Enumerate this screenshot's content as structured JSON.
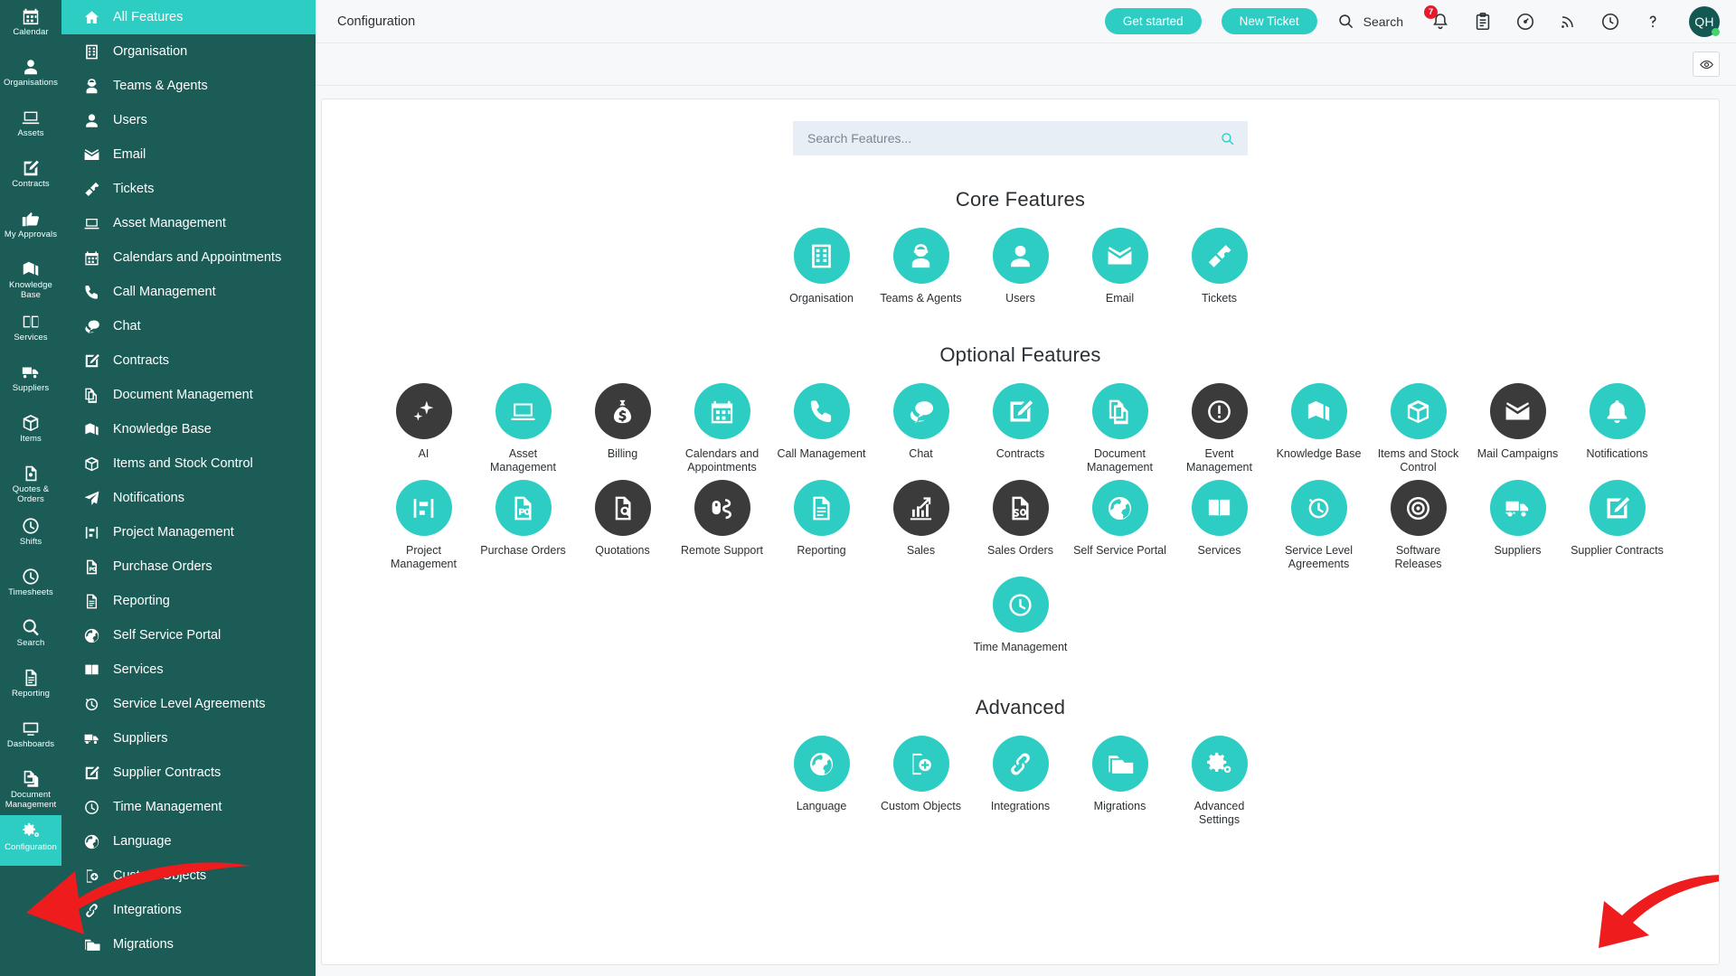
{
  "rail": {
    "items": [
      {
        "label": "Calendar",
        "icon": "calendar-icon",
        "active": false
      },
      {
        "label": "Organisations",
        "icon": "organisations-icon",
        "active": false
      },
      {
        "label": "Assets",
        "icon": "assets-icon",
        "active": false
      },
      {
        "label": "Contracts",
        "icon": "contracts-icon",
        "active": false
      },
      {
        "label": "My Approvals",
        "icon": "approvals-icon",
        "active": false
      },
      {
        "label": "Knowledge Base",
        "icon": "knowledge-base-icon",
        "active": false
      },
      {
        "label": "Services",
        "icon": "services-icon",
        "active": false
      },
      {
        "label": "Suppliers",
        "icon": "suppliers-icon",
        "active": false
      },
      {
        "label": "Items",
        "icon": "items-icon",
        "active": false
      },
      {
        "label": "Quotes & Orders",
        "icon": "quotes-orders-icon",
        "active": false
      },
      {
        "label": "Shifts",
        "icon": "shifts-icon",
        "active": false
      },
      {
        "label": "Timesheets",
        "icon": "timesheets-icon",
        "active": false
      },
      {
        "label": "Search",
        "icon": "search-icon",
        "active": false
      },
      {
        "label": "Reporting",
        "icon": "reporting-icon",
        "active": false
      },
      {
        "label": "Dashboards",
        "icon": "dashboards-icon",
        "active": false
      },
      {
        "label": "Document Management",
        "icon": "document-management-icon",
        "active": false
      },
      {
        "label": "Configuration",
        "icon": "configuration-icon",
        "active": true
      }
    ]
  },
  "featnav": {
    "items": [
      {
        "label": "All Features",
        "icon": "home-icon",
        "active": true
      },
      {
        "label": "Organisation",
        "icon": "building-icon",
        "active": false
      },
      {
        "label": "Teams & Agents",
        "icon": "agent-icon",
        "active": false
      },
      {
        "label": "Users",
        "icon": "user-icon",
        "active": false
      },
      {
        "label": "Email",
        "icon": "envelope-icon",
        "active": false
      },
      {
        "label": "Tickets",
        "icon": "ticket-icon",
        "active": false
      },
      {
        "label": "Asset Management",
        "icon": "laptop-icon",
        "active": false
      },
      {
        "label": "Calendars and Appointments",
        "icon": "calendar-icon",
        "active": false
      },
      {
        "label": "Call Management",
        "icon": "phone-icon",
        "active": false
      },
      {
        "label": "Chat",
        "icon": "chat-icon",
        "active": false
      },
      {
        "label": "Contracts",
        "icon": "pencil-square-icon",
        "active": false
      },
      {
        "label": "Document Management",
        "icon": "documents-icon",
        "active": false
      },
      {
        "label": "Knowledge Base",
        "icon": "books-icon",
        "active": false
      },
      {
        "label": "Items and Stock Control",
        "icon": "box-icon",
        "active": false
      },
      {
        "label": "Notifications",
        "icon": "paper-plane-icon",
        "active": false
      },
      {
        "label": "Project Management",
        "icon": "project-icon",
        "active": false
      },
      {
        "label": "Purchase Orders",
        "icon": "po-icon",
        "active": false
      },
      {
        "label": "Reporting",
        "icon": "report-icon",
        "active": false
      },
      {
        "label": "Self Service Portal",
        "icon": "globe-icon",
        "active": false
      },
      {
        "label": "Services",
        "icon": "book-open-icon",
        "active": false
      },
      {
        "label": "Service Level Agreements",
        "icon": "stopwatch-icon",
        "active": false
      },
      {
        "label": "Suppliers",
        "icon": "truck-icon",
        "active": false
      },
      {
        "label": "Supplier Contracts",
        "icon": "pencil-square-icon",
        "active": false
      },
      {
        "label": "Time Management",
        "icon": "clock-icon",
        "active": false
      },
      {
        "label": "Language",
        "icon": "globe-icon",
        "active": false
      },
      {
        "label": "Custom Objects",
        "icon": "custom-object-icon",
        "active": false
      },
      {
        "label": "Integrations",
        "icon": "link-icon",
        "active": false
      },
      {
        "label": "Migrations",
        "icon": "folder-icon",
        "active": false
      }
    ]
  },
  "topbar": {
    "title": "Configuration",
    "get_started_label": "Get started",
    "new_ticket_label": "New Ticket",
    "search_label": "Search",
    "notification_count": "7",
    "avatar_initials": "QH",
    "icons": [
      "bell-icon",
      "clipboard-icon",
      "gauge-icon",
      "rss-icon",
      "clock-icon",
      "help-icon"
    ]
  },
  "actionbar": {
    "eye_icon": "eye-icon"
  },
  "search": {
    "placeholder": "Search Features...",
    "value": ""
  },
  "sections": [
    {
      "title": "Core Features",
      "tiles": [
        {
          "label": "Organisation",
          "icon": "building-icon",
          "dark": false
        },
        {
          "label": "Teams & Agents",
          "icon": "agent-icon",
          "dark": false
        },
        {
          "label": "Users",
          "icon": "user-icon",
          "dark": false
        },
        {
          "label": "Email",
          "icon": "envelope-icon",
          "dark": false
        },
        {
          "label": "Tickets",
          "icon": "ticket-icon",
          "dark": false
        }
      ]
    },
    {
      "title": "Optional Features",
      "tiles": [
        {
          "label": "AI",
          "icon": "sparkles-icon",
          "dark": true
        },
        {
          "label": "Asset Management",
          "icon": "laptop-icon",
          "dark": false
        },
        {
          "label": "Billing",
          "icon": "money-bag-icon",
          "dark": true
        },
        {
          "label": "Calendars and Appointments",
          "icon": "calendar-icon",
          "dark": false
        },
        {
          "label": "Call Management",
          "icon": "phone-icon",
          "dark": false
        },
        {
          "label": "Chat",
          "icon": "chat-icon",
          "dark": false
        },
        {
          "label": "Contracts",
          "icon": "pencil-square-icon",
          "dark": false
        },
        {
          "label": "Document Management",
          "icon": "documents-icon",
          "dark": false
        },
        {
          "label": "Event Management",
          "icon": "exclamation-circle-icon",
          "dark": true
        },
        {
          "label": "Knowledge Base",
          "icon": "books-icon",
          "dark": false
        },
        {
          "label": "Items and Stock Control",
          "icon": "box-icon",
          "dark": false
        },
        {
          "label": "Mail Campaigns",
          "icon": "envelope-icon",
          "dark": true
        },
        {
          "label": "Notifications",
          "icon": "bell-icon",
          "dark": false
        },
        {
          "label": "Project Management",
          "icon": "project-icon",
          "dark": false
        },
        {
          "label": "Purchase Orders",
          "icon": "po-icon",
          "dark": false
        },
        {
          "label": "Quotations",
          "icon": "quotation-icon",
          "dark": true
        },
        {
          "label": "Remote Support",
          "icon": "remote-support-icon",
          "dark": true
        },
        {
          "label": "Reporting",
          "icon": "report-icon",
          "dark": false
        },
        {
          "label": "Sales",
          "icon": "sales-chart-icon",
          "dark": true
        },
        {
          "label": "Sales Orders",
          "icon": "so-icon",
          "dark": true
        },
        {
          "label": "Self Service Portal",
          "icon": "globe-icon",
          "dark": false
        },
        {
          "label": "Services",
          "icon": "book-open-icon",
          "dark": false
        },
        {
          "label": "Service Level Agreements",
          "icon": "stopwatch-icon",
          "dark": false
        },
        {
          "label": "Software Releases",
          "icon": "disc-icon",
          "dark": true
        },
        {
          "label": "Suppliers",
          "icon": "truck-icon",
          "dark": false
        },
        {
          "label": "Supplier Contracts",
          "icon": "pencil-square-icon",
          "dark": false
        },
        {
          "label": "Time Management",
          "icon": "clock-icon",
          "dark": false
        }
      ]
    },
    {
      "title": "Advanced",
      "tiles": [
        {
          "label": "Language",
          "icon": "globe-icon",
          "dark": false
        },
        {
          "label": "Custom Objects",
          "icon": "custom-object-icon",
          "dark": false
        },
        {
          "label": "Integrations",
          "icon": "link-icon",
          "dark": false
        },
        {
          "label": "Migrations",
          "icon": "folder-icon",
          "dark": false
        },
        {
          "label": "Advanced Settings",
          "icon": "gears-icon",
          "dark": false
        }
      ]
    }
  ],
  "annotations": [
    {
      "name": "arrow-advanced-settings",
      "color": "#ee1c1c"
    },
    {
      "name": "arrow-configuration",
      "color": "#ee1c1c"
    }
  ],
  "colors": {
    "accent": "#2ecdc4",
    "sidebar": "#1b5c57",
    "dark_bubble": "#3b3b3b",
    "badge": "#e8192c",
    "status_dot": "#42d66a",
    "arrow": "#ee1c1c"
  }
}
